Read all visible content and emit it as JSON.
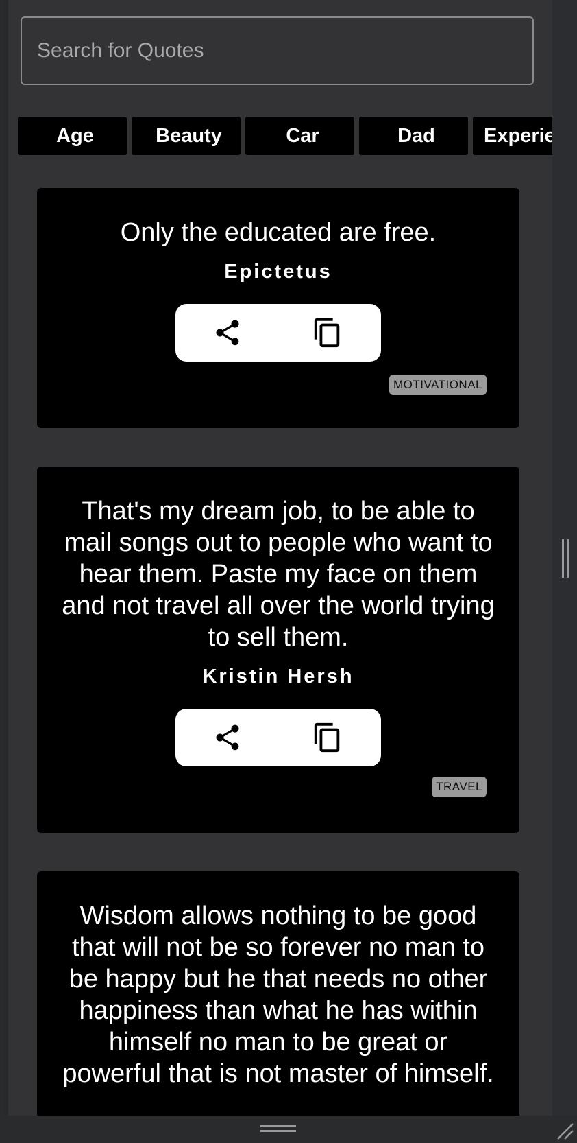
{
  "search": {
    "placeholder": "Search for Quotes",
    "value": ""
  },
  "categories": [
    "Age",
    "Beauty",
    "Car",
    "Dad",
    "Experie"
  ],
  "quotes": [
    {
      "text": "Only the educated are free.",
      "author": "Epictetus",
      "category": "MOTIVATIONAL",
      "actions": {
        "share_icon": "share-icon",
        "copy_icon": "copy-icon"
      }
    },
    {
      "text": "That's my dream job, to be able to mail songs out to people who want to hear them. Paste my face on them and not travel all over the world trying to sell them.",
      "author": "Kristin Hersh",
      "category": "TRAVEL",
      "actions": {
        "share_icon": "share-icon",
        "copy_icon": "copy-icon"
      }
    },
    {
      "text": "Wisdom allows nothing to be good that will not be so forever no man to be happy but he that needs no other happiness than what he has within himself no man to be great or powerful that is not master of himself."
    }
  ],
  "colors": {
    "background": "#333335",
    "card": "#000000",
    "badge": "#9b9b9b",
    "action_bar": "#ffffff"
  }
}
